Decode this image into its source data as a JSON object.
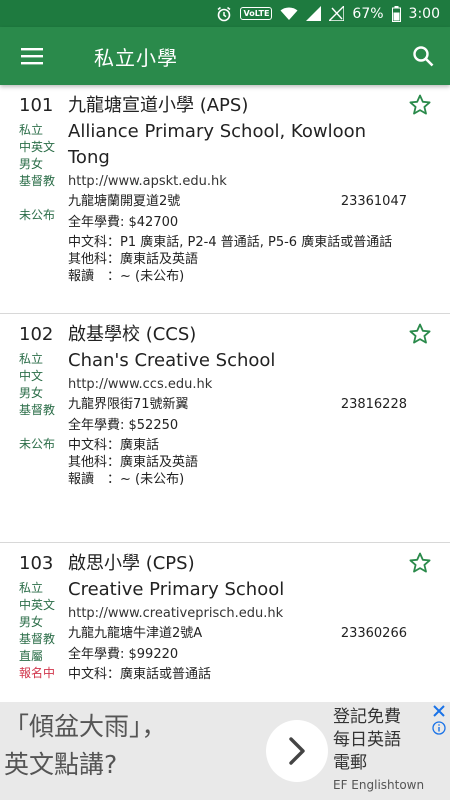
{
  "status_bar": {
    "volte": "VoLTE",
    "battery": "67%",
    "time": "3:00"
  },
  "app_bar": {
    "title": "私立小學"
  },
  "schools": [
    {
      "num": "101",
      "tags": [
        "私立",
        "中英文",
        "男女",
        "基督教"
      ],
      "status": "未公布",
      "zh_name": "九龍塘宣道小學 (APS)",
      "en_name": "Alliance Primary School, Kowloon Tong",
      "url": "http://www.apskt.edu.hk",
      "address": "九龍塘蘭開夏道2號",
      "phone": "23361047",
      "fee": "全年學費: $42700",
      "lang_rows": [
        {
          "k": "中文科",
          "v": "：P1 廣東話, P2-4 普通話, P5-6 廣東話或普通話"
        },
        {
          "k": "其他科",
          "v": "：廣東話及英語"
        },
        {
          "k": "報讀　",
          "v": "：~ (未公布)"
        }
      ]
    },
    {
      "num": "102",
      "tags": [
        "私立",
        "中文",
        "男女",
        "基督教"
      ],
      "status": "未公布",
      "zh_name": "啟基學校 (CCS)",
      "en_name": "Chan's Creative School",
      "url": "http://www.ccs.edu.hk",
      "address": "九龍界限街71號新翼",
      "phone": "23816228",
      "fee": "全年學費: $52250",
      "lang_rows": [
        {
          "k": "中文科",
          "v": "：廣東話"
        },
        {
          "k": "其他科",
          "v": "：廣東話及英語"
        },
        {
          "k": "報讀　",
          "v": "：~ (未公布)"
        }
      ]
    },
    {
      "num": "103",
      "tags": [
        "私立",
        "中英文",
        "男女",
        "基督教",
        "直屬"
      ],
      "status": "報名中",
      "zh_name": "啟思小學 (CPS)",
      "en_name": "Creative Primary School",
      "url": "http://www.creativeprisch.edu.hk",
      "address": "九龍九龍塘牛津道2號A",
      "phone": "23360266",
      "fee": "全年學費: $99220",
      "lang_rows": [
        {
          "k": "中文科",
          "v": "：廣東話或普通話"
        }
      ]
    }
  ],
  "ad": {
    "headline_line1": "「傾盆大雨」，",
    "headline_line2": "英文點講?",
    "promo_line1": "登記免費",
    "promo_line2": "每日英語",
    "promo_line3": "電郵",
    "brand": "EF Englishtown"
  },
  "colors": {
    "appbar": "#2a8a4b",
    "statusbar": "#1e7a3f",
    "star": "#2a8a4b",
    "tag": "#2c6e49",
    "registration_open": "#d0344a"
  }
}
